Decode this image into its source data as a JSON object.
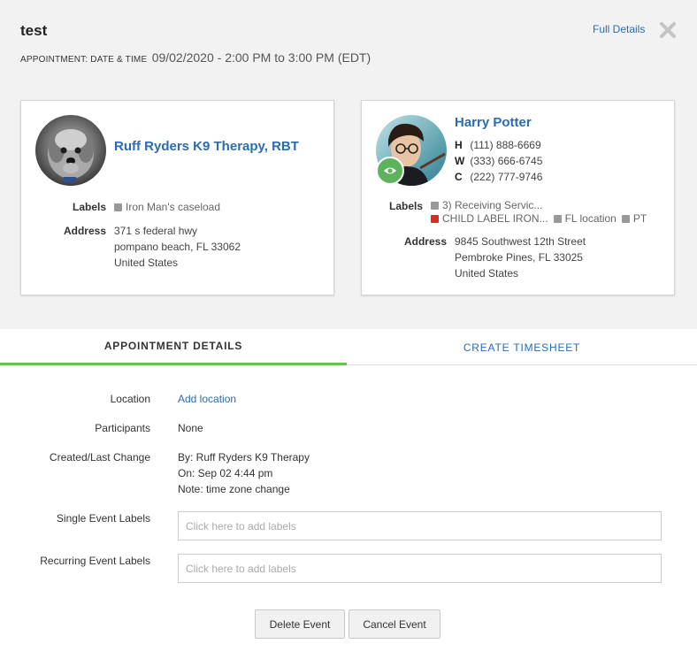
{
  "header": {
    "title": "test",
    "appointment_label": "Appointment: Date & Time",
    "appointment_value": "09/02/2020 - 2:00 PM to 3:00 PM (EDT)",
    "full_details": "Full Details",
    "close_icon": "close-icon"
  },
  "provider": {
    "name": "Ruff Ryders K9 Therapy, RBT",
    "avatar": "dog-photo-avatar",
    "labels_label": "Labels",
    "labels": [
      {
        "text": "Iron Man's caseload",
        "color": "#999999"
      }
    ],
    "address_label": "Address",
    "address": [
      "371 s federal hwy",
      "pompano beach, FL 33062",
      "United States"
    ]
  },
  "client": {
    "name": "Harry Potter",
    "avatar": "harry-potter-photo-avatar",
    "badge_icon": "eye-icon",
    "phones": [
      {
        "type": "H",
        "number": "(111) 888-6669"
      },
      {
        "type": "W",
        "number": "(333) 666-6745"
      },
      {
        "type": "C",
        "number": "(222) 777-9746"
      }
    ],
    "labels_label": "Labels",
    "labels": [
      {
        "text": "3) Receiving Servic...",
        "color": "#999999"
      },
      {
        "text": "CHILD LABEL IRON...",
        "color": "#e0281f"
      },
      {
        "text": "FL location",
        "color": "#999999"
      },
      {
        "text": "PT",
        "color": "#999999"
      }
    ],
    "address_label": "Address",
    "address": [
      "9845 Southwest 12th Street",
      "Pembroke Pines, FL 33025",
      "United States"
    ]
  },
  "tabs": [
    {
      "label": "Appointment Details",
      "active": true
    },
    {
      "label": "Create Timesheet",
      "active": false
    }
  ],
  "details": {
    "location_label": "Location",
    "location_value": "Add location",
    "participants_label": "Participants",
    "participants_value": "None",
    "created_label": "Created/Last Change",
    "created_lines": [
      "By: Ruff Ryders K9 Therapy",
      "On: Sep 02 4:44 pm",
      "Note: time zone change"
    ],
    "single_labels_label": "Single Event Labels",
    "single_labels_placeholder": "Click here to add labels",
    "recurring_labels_label": "Recurring Event Labels",
    "recurring_labels_placeholder": "Click here to add labels"
  },
  "buttons": {
    "delete": "Delete Event",
    "cancel": "Cancel Event"
  },
  "colors": {
    "link": "#2a6cb0",
    "active_tab_underline": "#6cbf4e",
    "eye_badge": "#5cb35c",
    "header_bg": "#f2f2f2"
  }
}
